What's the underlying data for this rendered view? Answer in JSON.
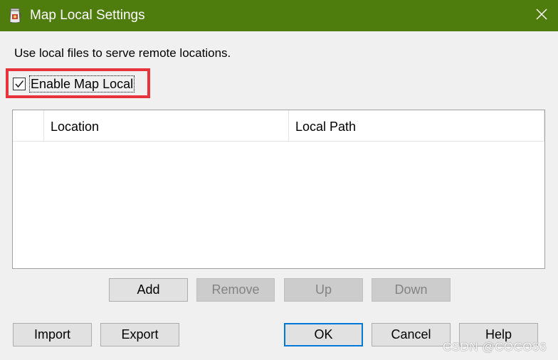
{
  "window": {
    "title": "Map Local Settings",
    "app_icon": "charles-jar-icon",
    "close_icon": "close-icon",
    "titlebar_color": "#4e7d0e"
  },
  "description": "Use local files to serve remote locations.",
  "enable_map_local": {
    "label": "Enable Map Local",
    "checked": true,
    "highlight_color": "#e8323c"
  },
  "table": {
    "columns": [
      "",
      "Location",
      "Local Path"
    ],
    "rows": []
  },
  "row_buttons": {
    "add": "Add",
    "remove": "Remove",
    "up": "Up",
    "down": "Down"
  },
  "footer_buttons": {
    "import": "Import",
    "export": "Export",
    "ok": "OK",
    "cancel": "Cancel",
    "help": "Help"
  },
  "watermark": "CSDN @COCO56"
}
